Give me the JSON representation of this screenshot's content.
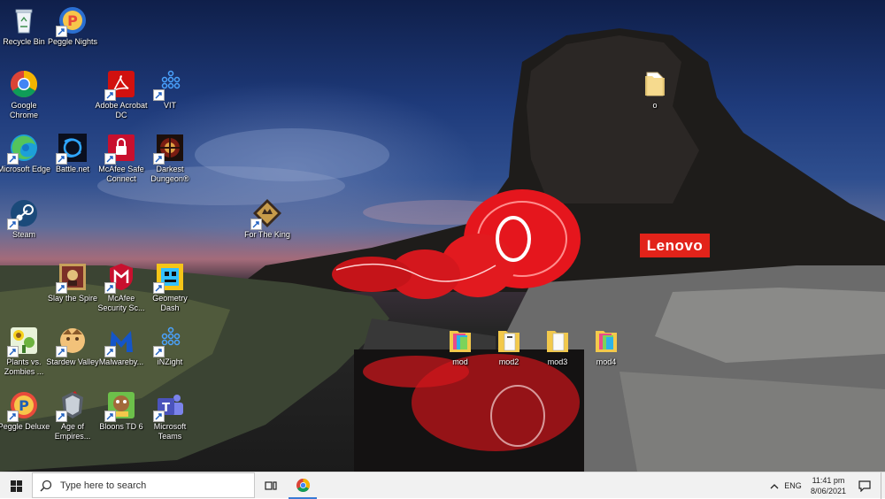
{
  "wallpaper": {
    "brand": "Lenovo"
  },
  "desktop_icons": [
    {
      "id": "recycle-bin",
      "label": "Recycle Bin",
      "icon": "recycle-bin-icon",
      "shortcut": false
    },
    {
      "id": "peggle-nights",
      "label": "Peggle Nights",
      "icon": "peggle-icon",
      "shortcut": true
    },
    {
      "id": "google-chrome",
      "label": "Google Chrome",
      "icon": "chrome-icon",
      "shortcut": false
    },
    {
      "id": "adobe-acrobat",
      "label": "Adobe Acrobat DC",
      "icon": "acrobat-icon",
      "shortcut": true
    },
    {
      "id": "vit",
      "label": "VIT",
      "icon": "dots-icon",
      "shortcut": true
    },
    {
      "id": "microsoft-edge",
      "label": "Microsoft Edge",
      "icon": "edge-icon",
      "shortcut": false
    },
    {
      "id": "battle-net",
      "label": "Battle.net",
      "icon": "battlenet-icon",
      "shortcut": true
    },
    {
      "id": "mcafee-safe-connect",
      "label": "McAfee Safe Connect",
      "icon": "mcafee-lock-icon",
      "shortcut": true
    },
    {
      "id": "darkest-dungeon",
      "label": "Darkest Dungeon®",
      "icon": "darkest-dungeon-icon",
      "shortcut": true
    },
    {
      "id": "steam",
      "label": "Steam",
      "icon": "steam-icon",
      "shortcut": true
    },
    {
      "id": "for-the-king",
      "label": "For The King",
      "icon": "for-the-king-icon",
      "shortcut": true
    },
    {
      "id": "slay-the-spire",
      "label": "Slay the Spire",
      "icon": "slay-the-spire-icon",
      "shortcut": true
    },
    {
      "id": "mcafee-security",
      "label": "McAfee Security Sc...",
      "icon": "mcafee-shield-icon",
      "shortcut": true
    },
    {
      "id": "geometry-dash",
      "label": "Geometry Dash",
      "icon": "geometry-dash-icon",
      "shortcut": true
    },
    {
      "id": "plants-vs-zombies",
      "label": "Plants vs. Zombies ...",
      "icon": "plants-vs-zombies-icon",
      "shortcut": true
    },
    {
      "id": "stardew-valley",
      "label": "Stardew Valley",
      "icon": "stardew-icon",
      "shortcut": true
    },
    {
      "id": "malwarebytes",
      "label": "Malwareby...",
      "icon": "malwarebytes-icon",
      "shortcut": true
    },
    {
      "id": "inzight",
      "label": "iNZight",
      "icon": "dots-icon",
      "shortcut": true
    },
    {
      "id": "peggle-deluxe",
      "label": "Peggle Deluxe",
      "icon": "peggle-icon",
      "shortcut": true
    },
    {
      "id": "age-of-empires",
      "label": "Age of Empires...",
      "icon": "age-of-empires-icon",
      "shortcut": true
    },
    {
      "id": "bloons-td-6",
      "label": "Bloons TD 6",
      "icon": "bloons-icon",
      "shortcut": true
    },
    {
      "id": "microsoft-teams",
      "label": "Microsoft Teams",
      "icon": "teams-icon",
      "shortcut": true
    },
    {
      "id": "folder-o",
      "label": "o",
      "icon": "folder-icon",
      "shortcut": false
    },
    {
      "id": "folder-mod",
      "label": "mod",
      "icon": "folder-colorful-icon",
      "shortcut": false
    },
    {
      "id": "folder-mod2",
      "label": "mod2",
      "icon": "folder-icon",
      "shortcut": false
    },
    {
      "id": "folder-mod3",
      "label": "mod3",
      "icon": "folder-icon",
      "shortcut": false
    },
    {
      "id": "folder-mod4",
      "label": "mod4",
      "icon": "folder-colorful-icon",
      "shortcut": false
    }
  ],
  "taskbar": {
    "search_placeholder": "Type here to search",
    "language": "ENG",
    "time": "11:41 pm",
    "date": "8/06/2021",
    "pinned": [
      "task-view-icon",
      "chrome-icon"
    ]
  },
  "colors": {
    "taskbar_bg": "#f1f1f1",
    "brand_red": "#e2231a",
    "active_indicator": "#3a7bd5"
  }
}
